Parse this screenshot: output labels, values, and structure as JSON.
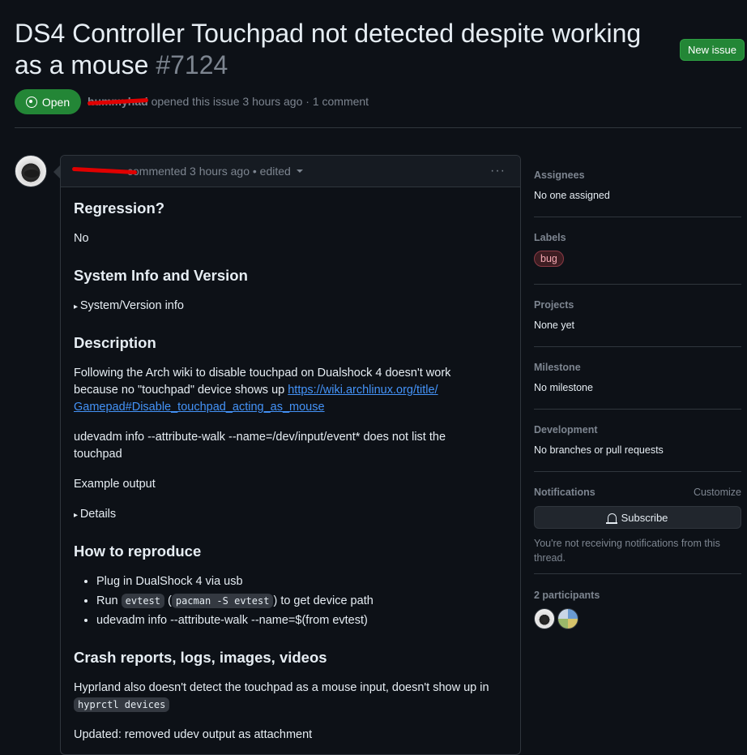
{
  "issue": {
    "title": "DS4 Controller Touchpad not detected despite working as a mouse",
    "number": "#7124",
    "state": "Open",
    "author": "hummyhad",
    "opened_text": "opened this issue 3 hours ago · 1 comment"
  },
  "header": {
    "new_issue_label": "New issue"
  },
  "comment": {
    "author": "hummyhad",
    "meta": "commented 3 hours ago • edited",
    "more": "···",
    "sections": {
      "regression_h": "Regression?",
      "regression_v": "No",
      "sysinfo_h": "System Info and Version",
      "sysinfo_summary": "System/Version info",
      "desc_h": "Description",
      "desc_p1": "Following the Arch wiki to disable touchpad on Dualshock 4 doesn't work because no \"touchpad\" device shows up",
      "desc_link": "https://wiki.archlinux.org/title/Gamepad#Disable_touchpad_acting_as_mouse",
      "desc_link_l1": "https://wiki.archlinux.org/title/",
      "desc_link_l2": "Gamepad#Disable_touchpad_acting_as_mouse",
      "desc_p2": "udevadm info --attribute-walk --name=/dev/input/event* does not list the touchpad",
      "desc_p3": "Example output",
      "details_summary": "Details",
      "repro_h": "How to reproduce",
      "repro_1": "Plug in DualShock 4 via usb",
      "repro_2_a": "Run",
      "repro_2_code1": "evtest",
      "repro_2_code2": "pacman -S evtest",
      "repro_2_b": "to get device path",
      "repro_3": "udevadm info --attribute-walk --name=$(from evtest)",
      "crash_h": "Crash reports, logs, images, videos",
      "crash_p1": "Hyprland also doesn't detect the touchpad as a mouse input, doesn't show up in",
      "crash_code": "hyprctl devices",
      "crash_p2": "Updated: removed udev output as attachment"
    }
  },
  "sidebar": {
    "assignees_h": "Assignees",
    "assignees_v": "No one assigned",
    "labels_h": "Labels",
    "labels": [
      "bug"
    ],
    "projects_h": "Projects",
    "projects_v": "None yet",
    "milestone_h": "Milestone",
    "milestone_v": "No milestone",
    "development_h": "Development",
    "development_v": "No branches or pull requests",
    "notifications_h": "Notifications",
    "customize": "Customize",
    "subscribe": "Subscribe",
    "notify_note": "You're not receiving notifications from this thread.",
    "participants_h": "2 participants"
  },
  "colors": {
    "background": "#0d1117",
    "open_green": "#238636",
    "link": "#4493f8",
    "bug_label": "#f4a8b2",
    "redaction": "#e00000"
  }
}
